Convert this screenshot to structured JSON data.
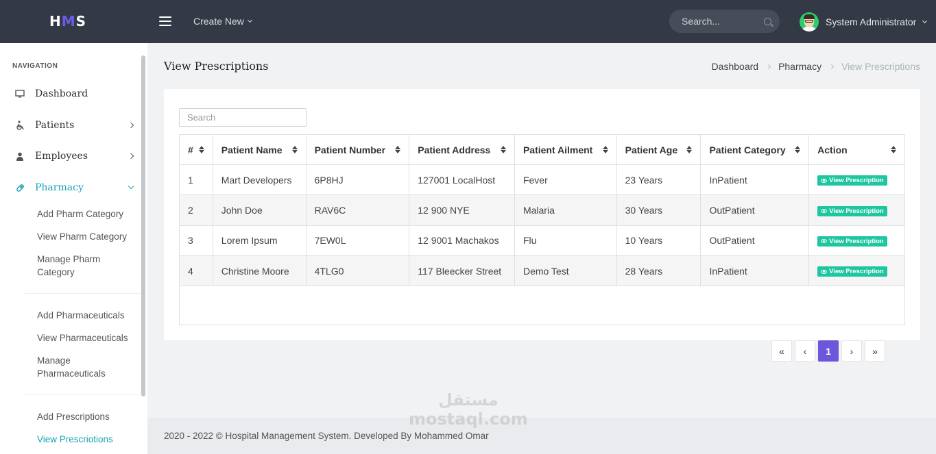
{
  "app": {
    "logo_text": "HMS",
    "create_new_label": "Create New",
    "search_placeholder": "Search...",
    "user_name": "System Administrator"
  },
  "sidebar": {
    "heading": "NAVIGATION",
    "items": [
      {
        "label": "Dashboard",
        "icon": "monitor-icon"
      },
      {
        "label": "Patients",
        "icon": "wheelchair-icon"
      },
      {
        "label": "Employees",
        "icon": "user-icon"
      },
      {
        "label": "Pharmacy",
        "icon": "pill-icon"
      }
    ],
    "subitems": [
      {
        "label": "Add Pharm Category"
      },
      {
        "label": "View Pharm Category"
      },
      {
        "label": "Manage Pharm Category"
      },
      {
        "label": "Add Pharmaceuticals"
      },
      {
        "label": "View Pharmaceuticals"
      },
      {
        "label": "Manage Pharmaceuticals"
      },
      {
        "label": "Add Prescriptions"
      },
      {
        "label": "View Prescriotions"
      }
    ]
  },
  "page": {
    "title": "View Prescriptions",
    "breadcrumb": [
      "Dashboard",
      "Pharmacy",
      "View Prescriptions"
    ]
  },
  "table": {
    "search_placeholder": "Search",
    "columns": [
      "#",
      "Patient Name",
      "Patient Number",
      "Patient Address",
      "Patient Ailment",
      "Patient Age",
      "Patient Category",
      "Action"
    ],
    "rows": [
      {
        "num": "1",
        "name": "Mart Developers",
        "number": "6P8HJ",
        "address": "127001 LocalHost",
        "ailment": "Fever",
        "age": "23 Years",
        "category": "InPatient",
        "action": "View Prescription"
      },
      {
        "num": "2",
        "name": "John Doe",
        "number": "RAV6C",
        "address": "12 900 NYE",
        "ailment": "Malaria",
        "age": "30 Years",
        "category": "OutPatient",
        "action": "View Prescription"
      },
      {
        "num": "3",
        "name": "Lorem Ipsum",
        "number": "7EW0L",
        "address": "12 9001 Machakos",
        "ailment": "Flu",
        "age": "10 Years",
        "category": "OutPatient",
        "action": "View Prescription"
      },
      {
        "num": "4",
        "name": "Christine Moore",
        "number": "4TLG0",
        "address": "117 Bleecker Street",
        "ailment": "Demo Test",
        "age": "28 Years",
        "category": "InPatient",
        "action": "View Prescription"
      }
    ],
    "pagination": {
      "first": "«",
      "prev": "‹",
      "current": "1",
      "next": "›",
      "last": "»"
    }
  },
  "footer": {
    "text": "2020 - 2022 © Hospital Management System. Developed By Mohammed Omar"
  },
  "watermark": {
    "line1": "مستقل",
    "line2": "mostaql.com"
  },
  "colors": {
    "accent": "#6c56d9",
    "active_nav": "#1aa3b6",
    "view_button": "#1ec6a0",
    "topbar": "#343a45"
  }
}
